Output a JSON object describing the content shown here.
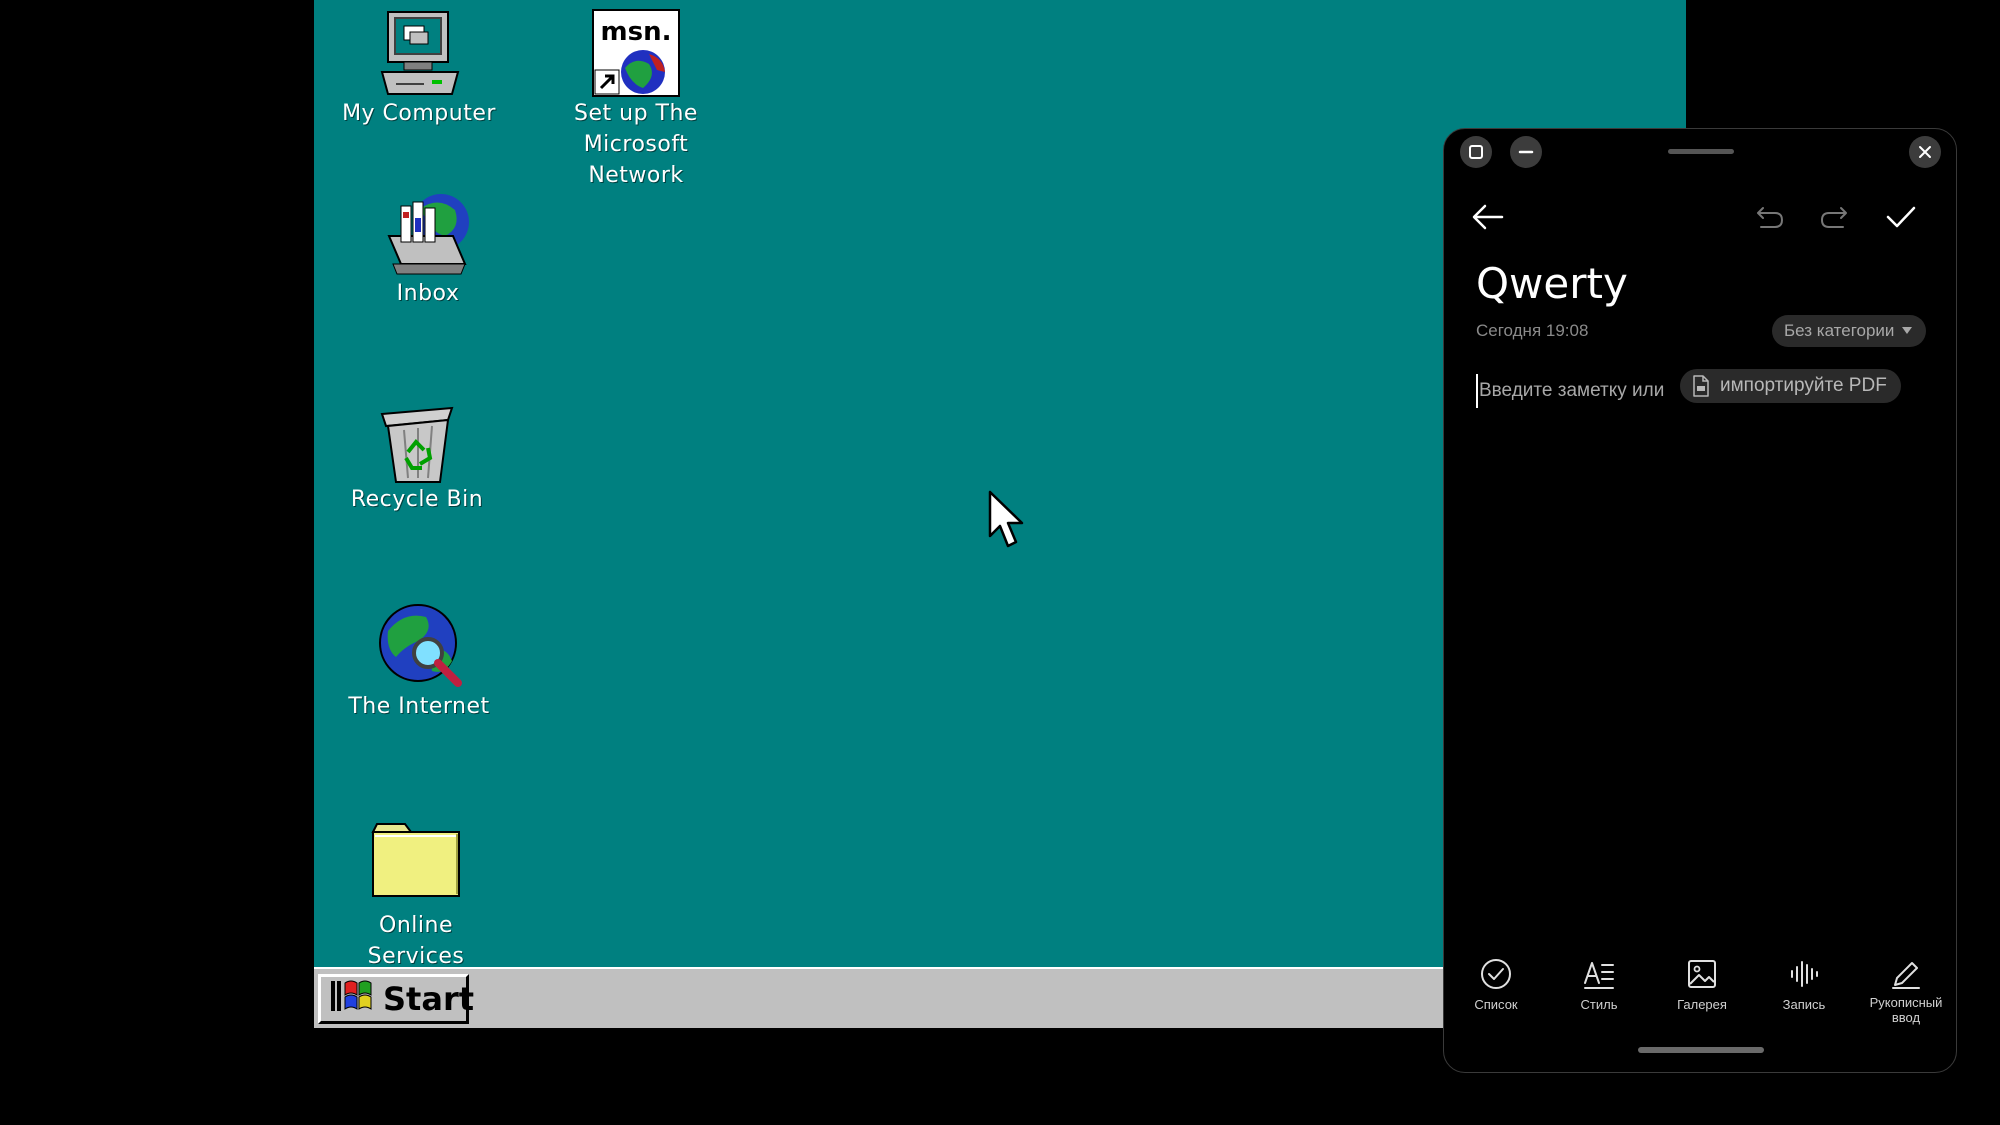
{
  "desktop": {
    "background": "#008080",
    "icons": [
      {
        "label_lines": [
          "My Computer"
        ],
        "icon": "my-computer-icon"
      },
      {
        "label_lines": [
          "Set up The",
          "Microsoft",
          "Network"
        ],
        "icon": "msn-icon",
        "logo_text": "msn."
      },
      {
        "label_lines": [
          "Inbox"
        ],
        "icon": "inbox-icon"
      },
      {
        "label_lines": [
          "Recycle Bin"
        ],
        "icon": "recycle-bin-icon"
      },
      {
        "label_lines": [
          "The Internet"
        ],
        "icon": "internet-globe-icon"
      },
      {
        "label_lines": [
          "Online",
          "Services"
        ],
        "icon": "folder-icon"
      }
    ]
  },
  "taskbar": {
    "start_label": "Start",
    "background": "#c0c0c0"
  },
  "notes": {
    "title": "Qwerty",
    "date": "Сегодня 19:08",
    "category": "Без категории",
    "placeholder": "Введите заметку или",
    "import_label": "импортируйте PDF",
    "toolbar": [
      {
        "label_lines": [
          "Список"
        ],
        "icon": "checklist-icon"
      },
      {
        "label_lines": [
          "Стиль"
        ],
        "icon": "text-style-icon"
      },
      {
        "label_lines": [
          "Галерея"
        ],
        "icon": "gallery-icon"
      },
      {
        "label_lines": [
          "Запись"
        ],
        "icon": "audio-record-icon"
      },
      {
        "label_lines": [
          "Рукописный",
          "ввод"
        ],
        "icon": "handwriting-icon"
      }
    ]
  }
}
